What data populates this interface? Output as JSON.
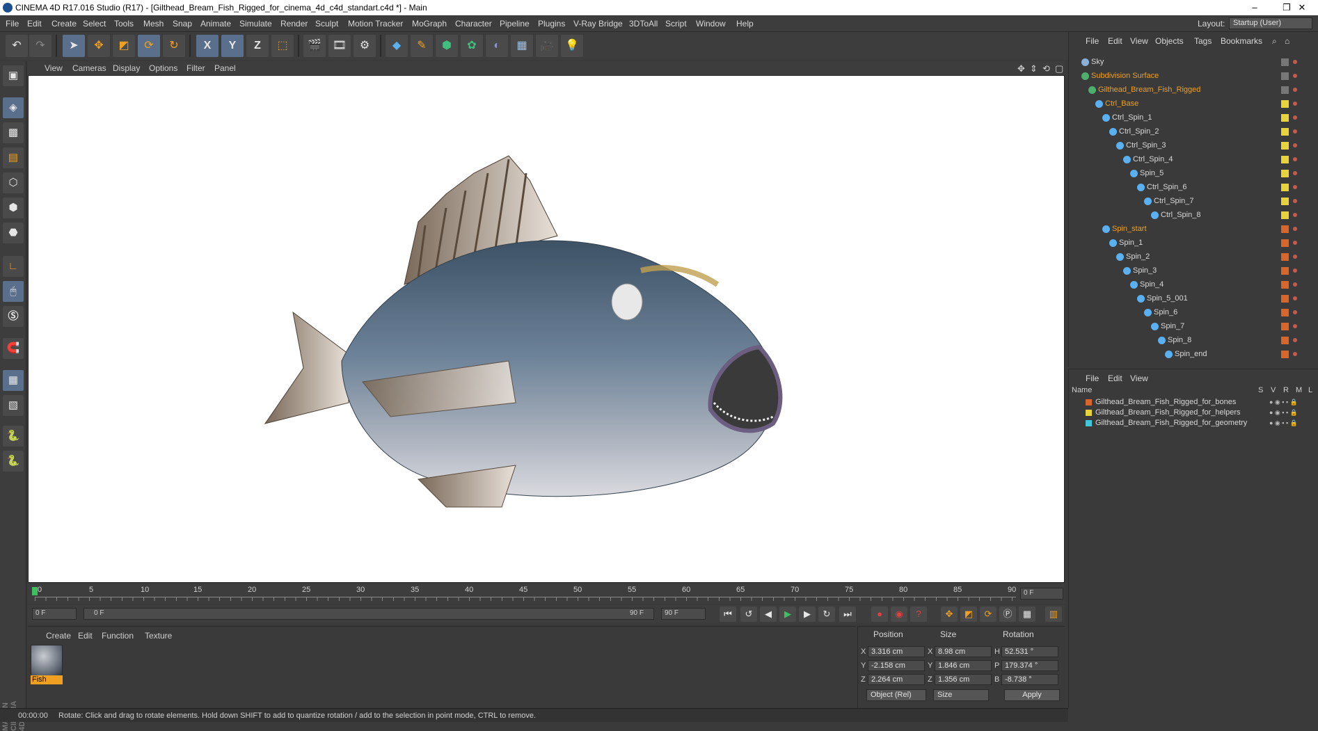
{
  "window": {
    "title": "CINEMA 4D R17.016 Studio (R17) - [Gilthead_Bream_Fish_Rigged_for_cinema_4d_c4d_standart.c4d *] - Main",
    "minimize": "–",
    "restore": "❐",
    "close": "✕"
  },
  "menu": {
    "items": [
      "File",
      "Edit",
      "Create",
      "Select",
      "Tools",
      "Mesh",
      "Snap",
      "Animate",
      "Simulate",
      "Render",
      "Sculpt",
      "Motion Tracker",
      "MoGraph",
      "Character",
      "Pipeline",
      "Plugins",
      "V-Ray Bridge",
      "3DToAll",
      "Script",
      "Window",
      "Help"
    ],
    "layout_label": "Layout:",
    "layout_value": "Startup (User)"
  },
  "toolbar": {
    "icons": [
      "undo-icon",
      "redo-icon",
      "select-arrow-icon",
      "move-icon",
      "scale-icon",
      "rotate-icon",
      "recent-tool-icon",
      "x-axis-icon",
      "y-axis-icon",
      "z-axis-icon",
      "coord-system-icon",
      "render-view-icon",
      "render-picture-viewer-icon",
      "edit-render-settings-icon",
      "cube-icon",
      "pen-icon",
      "subdivision-icon",
      "mograph-cloner-icon",
      "deformer-icon",
      "floor-icon",
      "camera-icon",
      "light-icon"
    ],
    "x_label": "X",
    "y_label": "Y",
    "z_label": "Z"
  },
  "viewport": {
    "menu": [
      "View",
      "Cameras",
      "Display",
      "Options",
      "Filter",
      "Panel"
    ]
  },
  "timeline": {
    "ticks": [
      "0",
      "5",
      "10",
      "15",
      "20",
      "25",
      "30",
      "35",
      "40",
      "45",
      "50",
      "55",
      "60",
      "65",
      "70",
      "75",
      "80",
      "85",
      "90"
    ],
    "current_frame": "0 F",
    "start_field": "0 F",
    "slider_start": "0 F",
    "slider_end": "90 F",
    "end_field": "90 F"
  },
  "material_manager": {
    "menu": [
      "Create",
      "Edit",
      "Function",
      "Texture"
    ],
    "material_name": "Fish"
  },
  "attributes": {
    "headers": [
      "Position",
      "Size",
      "Rotation"
    ],
    "rows": [
      {
        "axis": "X",
        "pos": "3.316 cm",
        "size_axis": "X",
        "size": "8.98 cm",
        "rot_axis": "H",
        "rot": "52.531 °"
      },
      {
        "axis": "Y",
        "pos": "-2.158 cm",
        "size_axis": "Y",
        "size": "1.846 cm",
        "rot_axis": "P",
        "rot": "179.374 °"
      },
      {
        "axis": "Z",
        "pos": "2.264 cm",
        "size_axis": "Z",
        "size": "1.356 cm",
        "rot_axis": "B",
        "rot": "-8.738 °"
      }
    ],
    "coord_mode": "Object (Rel)",
    "size_mode": "Size",
    "apply_label": "Apply"
  },
  "status": {
    "time": "00:00:00",
    "message": "Rotate: Click and drag to rotate elements. Hold down SHIFT to add to quantize rotation / add to the selection in point mode, CTRL to remove."
  },
  "object_manager": {
    "menu": [
      "File",
      "Edit",
      "View",
      "Objects",
      "Tags",
      "Bookmarks"
    ],
    "objects": [
      {
        "name": "Sky",
        "depth": 0,
        "color": "#d8d8d8",
        "tag": "#777777"
      },
      {
        "name": "Subdivision Surface",
        "depth": 0,
        "color": "#f0a020",
        "tag": "#777777"
      },
      {
        "name": "Gilthead_Bream_Fish_Rigged",
        "depth": 1,
        "color": "#f0a020",
        "tag": "#777777"
      },
      {
        "name": "Ctrl_Base",
        "depth": 2,
        "color": "#f0a020",
        "tag": "#e8d43a"
      },
      {
        "name": "Ctrl_Spin_1",
        "depth": 3,
        "color": "#d8d8d8",
        "tag": "#e8d43a"
      },
      {
        "name": "Ctrl_Spin_2",
        "depth": 4,
        "color": "#d8d8d8",
        "tag": "#e8d43a"
      },
      {
        "name": "Ctrl_Spin_3",
        "depth": 5,
        "color": "#d8d8d8",
        "tag": "#e8d43a"
      },
      {
        "name": "Ctrl_Spin_4",
        "depth": 6,
        "color": "#d8d8d8",
        "tag": "#e8d43a"
      },
      {
        "name": "Spin_5",
        "depth": 7,
        "color": "#d8d8d8",
        "tag": "#e8d43a"
      },
      {
        "name": "Ctrl_Spin_6",
        "depth": 8,
        "color": "#d8d8d8",
        "tag": "#e8d43a"
      },
      {
        "name": "Ctrl_Spin_7",
        "depth": 9,
        "color": "#d8d8d8",
        "tag": "#e8d43a"
      },
      {
        "name": "Ctrl_Spin_8",
        "depth": 10,
        "color": "#d8d8d8",
        "tag": "#e8d43a"
      },
      {
        "name": "Spin_start",
        "depth": 3,
        "color": "#f0a020",
        "tag": "#d8652a"
      },
      {
        "name": "Spin_1",
        "depth": 4,
        "color": "#d8d8d8",
        "tag": "#d8652a"
      },
      {
        "name": "Spin_2",
        "depth": 5,
        "color": "#d8d8d8",
        "tag": "#d8652a"
      },
      {
        "name": "Spin_3",
        "depth": 6,
        "color": "#d8d8d8",
        "tag": "#d8652a"
      },
      {
        "name": "Spin_4",
        "depth": 7,
        "color": "#d8d8d8",
        "tag": "#d8652a"
      },
      {
        "name": "Spin_5_001",
        "depth": 8,
        "color": "#d8d8d8",
        "tag": "#d8652a"
      },
      {
        "name": "Spin_6",
        "depth": 9,
        "color": "#d8d8d8",
        "tag": "#d8652a"
      },
      {
        "name": "Spin_7",
        "depth": 10,
        "color": "#d8d8d8",
        "tag": "#d8652a"
      },
      {
        "name": "Spin_8",
        "depth": 11,
        "color": "#d8d8d8",
        "tag": "#d8652a"
      },
      {
        "name": "Spin_end",
        "depth": 12,
        "color": "#d8d8d8",
        "tag": "#d8652a"
      }
    ]
  },
  "layer_manager": {
    "menu": [
      "File",
      "Edit",
      "View"
    ],
    "columns": {
      "name": "Name",
      "s": "S",
      "v": "V",
      "r": "R",
      "m": "M",
      "l": "L"
    },
    "layers": [
      {
        "name": "Gilthead_Bream_Fish_Rigged_for_bones",
        "color": "#d8652a"
      },
      {
        "name": "Gilthead_Bream_Fish_Rigged_for_helpers",
        "color": "#e8d43a"
      },
      {
        "name": "Gilthead_Bream_Fish_Rigged_for_geometry",
        "color": "#3ec8d8"
      }
    ]
  }
}
